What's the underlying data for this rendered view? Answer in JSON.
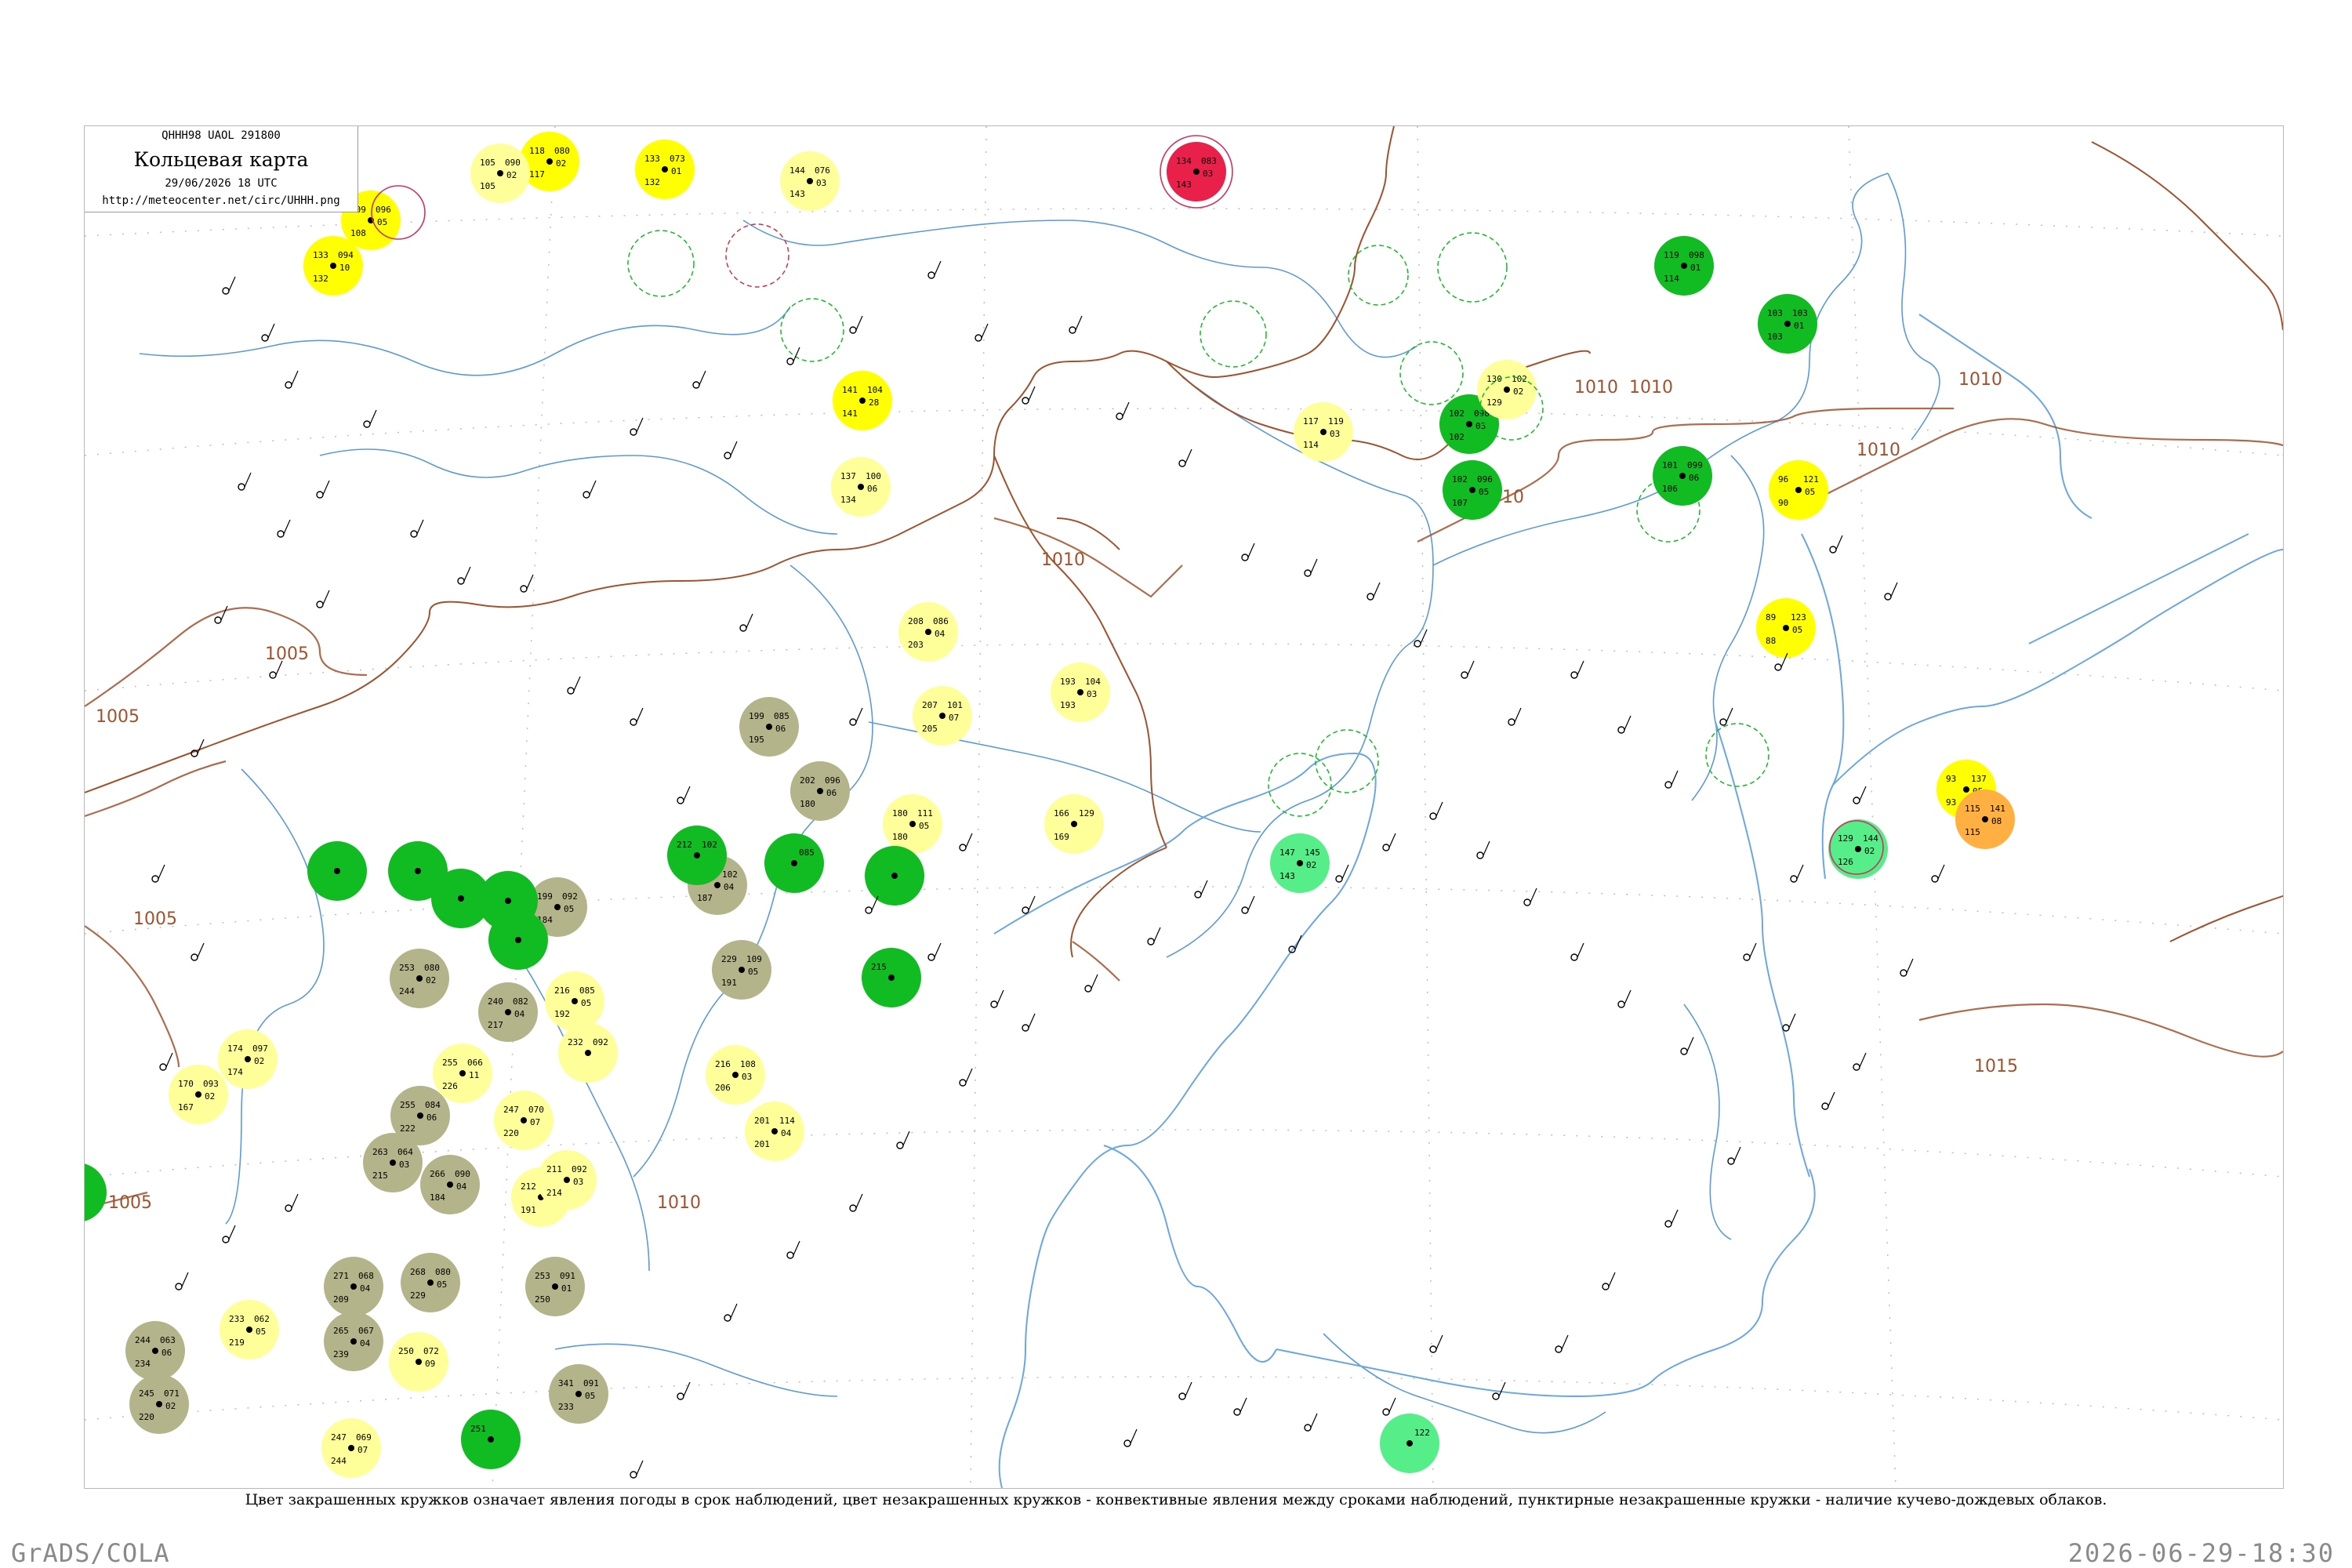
{
  "header": {
    "code_line": "QHHH98  UAOL  291800",
    "title": "Кольцевая карта",
    "datetime": "29/06/2026 18 UTC",
    "url": "http://meteocenter.net/circ/UHHH.png"
  },
  "caption": "Цвет закрашенных кружков означает явления погоды в срок наблюдений, цвет незакрашенных кружков - конвективные явления между сроками наблюдений, пунктирные незакрашенные кружки - наличие кучево-дождевых облаков.",
  "footer": {
    "left": "GrADS/COLA",
    "right": "2026-06-29-18:30"
  },
  "colors": {
    "isobar": "#a0522d",
    "river": "#5b9bd5",
    "coast": "#6aa7e0",
    "green_obs": "#11bb22",
    "yellow_obs": "#ffff00",
    "light_yellow_obs": "#ffff99",
    "olive_obs": "#b4b48a",
    "red_obs": "#e8204a",
    "light_green_obs": "#55ee88",
    "orange_obs": "#ffb040"
  },
  "isobar_labels": [
    "1005",
    "1005",
    "1005",
    "1005",
    "1010",
    "1010",
    "1010",
    "1010",
    "1010",
    "1010",
    "1010",
    "1015"
  ],
  "stations": [
    {
      "id": "31004",
      "top": "118",
      "bot": "117",
      "dp": "080",
      "tend": "02",
      "color": "yellow_obs"
    },
    {
      "id": "30469",
      "top": "133",
      "bot": "132",
      "dp": "073",
      "tend": "01",
      "color": "yellow_obs"
    },
    {
      "id": "31052",
      "top": "144",
      "bot": "143",
      "dp": "076",
      "tend": "03",
      "color": "light_yellow_obs"
    },
    {
      "id": "31707",
      "top": "134",
      "bot": "143",
      "dp": "083",
      "tend": "03",
      "color": "red_obs"
    },
    {
      "id": "30253",
      "top": "109",
      "bot": "108",
      "dp": "096",
      "tend": "05",
      "color": "yellow_obs"
    },
    {
      "id": "30554",
      "top": "133",
      "bot": "132",
      "dp": "094",
      "tend": "10",
      "color": "yellow_obs"
    },
    {
      "id": "30746",
      "top": "105",
      "bot": "105",
      "dp": "090",
      "tend": "02",
      "color": "light_yellow_obs"
    },
    {
      "id": "31348",
      "top": "141",
      "bot": "141",
      "dp": "104",
      "tend": "28",
      "color": "yellow_obs"
    },
    {
      "id": "31329",
      "top": "137",
      "bot": "134",
      "dp": "100",
      "tend": "06",
      "color": "light_yellow_obs"
    },
    {
      "id": "31169",
      "top": "119",
      "bot": "114",
      "dp": "098",
      "tend": "01",
      "color": "green_obs"
    },
    {
      "id": "31285",
      "top": "103",
      "bot": "103",
      "dp": "103",
      "tend": "01",
      "color": "green_obs"
    },
    {
      "id": "31348a",
      "top": "101",
      "bot": "106",
      "dp": "099",
      "tend": "06",
      "color": "green_obs"
    },
    {
      "id": "31621",
      "top": "117",
      "bot": "114",
      "dp": "119",
      "tend": "03",
      "color": "light_yellow_obs"
    },
    {
      "id": "31532",
      "top": "102",
      "bot": "102",
      "dp": "098",
      "tend": "03",
      "color": "green_obs"
    },
    {
      "id": "31418",
      "top": "130",
      "bot": "129",
      "dp": "102",
      "tend": "02",
      "color": "light_yellow_obs"
    },
    {
      "id": "31445",
      "top": "102",
      "bot": "107",
      "dp": "096",
      "tend": "05",
      "color": "green_obs"
    },
    {
      "id": "31298",
      "top": "96",
      "bot": "90",
      "dp": "121",
      "tend": "05",
      "color": "yellow_obs"
    },
    {
      "id": "31595",
      "top": "89",
      "bot": "88",
      "dp": "123",
      "tend": "05",
      "color": "yellow_obs"
    },
    {
      "id": "32098",
      "top": "93",
      "bot": "93",
      "dp": "137",
      "tend": "05",
      "color": "yellow_obs"
    },
    {
      "id": "32061",
      "top": "115",
      "bot": "115",
      "dp": "141",
      "tend": "08",
      "color": "orange_obs"
    },
    {
      "id": "47451",
      "top": "129",
      "bot": "126",
      "dp": "144",
      "tend": "02",
      "color": "light_green_obs"
    },
    {
      "id": "31960",
      "top": "147",
      "bot": "143",
      "dp": "145",
      "tend": "02",
      "color": "light_green_obs"
    },
    {
      "id": "50945",
      "top": "208",
      "bot": "203",
      "dp": "086",
      "tend": "04",
      "color": "light_yellow_obs"
    },
    {
      "id": "54026",
      "top": "199",
      "bot": "195",
      "dp": "085",
      "tend": "06",
      "color": "olive_obs"
    },
    {
      "id": "50949",
      "top": "207",
      "bot": "205",
      "dp": "101",
      "tend": "07",
      "color": "light_yellow_obs"
    },
    {
      "id": "50983",
      "top": "193",
      "bot": "193",
      "dp": "104",
      "tend": "03",
      "color": "light_yellow_obs"
    },
    {
      "id": "54094",
      "top": "202",
      "bot": "180",
      "dp": "096",
      "tend": "06",
      "color": "olive_obs"
    },
    {
      "id": "54157",
      "top": "180",
      "bot": "180",
      "dp": "111",
      "tend": "05",
      "color": "light_yellow_obs"
    },
    {
      "id": "54186",
      "top": "166",
      "bot": "169",
      "dp": "129",
      "tend": "",
      "color": "light_yellow_obs"
    },
    {
      "id": "54363",
      "top": "199",
      "bot": "184",
      "dp": "092",
      "tend": "05",
      "color": "olive_obs"
    },
    {
      "id": "54337",
      "top": "197",
      "bot": "187",
      "dp": "102",
      "tend": "04",
      "color": "olive_obs"
    },
    {
      "id": "54471",
      "top": "229",
      "bot": "191",
      "dp": "109",
      "tend": "05",
      "color": "olive_obs"
    },
    {
      "id": "54662",
      "top": "216",
      "bot": "206",
      "dp": "108",
      "tend": "03",
      "color": "light_yellow_obs"
    },
    {
      "id": "54776",
      "top": "201",
      "bot": "201",
      "dp": "114",
      "tend": "04",
      "color": "light_yellow_obs"
    },
    {
      "id": "54342",
      "top": "212",
      "bot": "",
      "dp": "102",
      "tend": "",
      "color": "green_obs"
    },
    {
      "id": "54493",
      "top": "215",
      "bot": "",
      "dp": "",
      "tend": "",
      "color": "green_obs"
    },
    {
      "id": "53698",
      "top": "253",
      "bot": "244",
      "dp": "080",
      "tend": "02",
      "color": "olive_obs"
    },
    {
      "id": "53772",
      "top": "240",
      "bot": "217",
      "dp": "082",
      "tend": "04",
      "color": "olive_obs"
    },
    {
      "id": "53915",
      "top": "255",
      "bot": "226",
      "dp": "066",
      "tend": "11",
      "color": "light_yellow_obs"
    },
    {
      "id": "54218",
      "top": "216",
      "bot": "192",
      "dp": "085",
      "tend": "05",
      "color": "light_yellow_obs"
    },
    {
      "id": "54308",
      "top": "232",
      "bot": "",
      "dp": "092",
      "tend": "",
      "color": "light_yellow_obs"
    },
    {
      "id": "53913",
      "top": "255",
      "bot": "222",
      "dp": "084",
      "tend": "06",
      "color": "olive_obs"
    },
    {
      "id": "53959",
      "top": "247",
      "bot": "220",
      "dp": "070",
      "tend": "07",
      "color": "light_yellow_obs"
    },
    {
      "id": "53787",
      "top": "174",
      "bot": "174",
      "dp": "097",
      "tend": "02",
      "color": "light_yellow_obs"
    },
    {
      "id": "53863",
      "top": "170",
      "bot": "167",
      "dp": "093",
      "tend": "02",
      "color": "light_yellow_obs"
    },
    {
      "id": "57083",
      "top": "263",
      "bot": "215",
      "dp": "064",
      "tend": "03",
      "color": "olive_obs"
    },
    {
      "id": "57178",
      "top": "266",
      "bot": "184",
      "dp": "090",
      "tend": "04",
      "color": "olive_obs"
    },
    {
      "id": "57245",
      "top": "212",
      "bot": "191",
      "dp": "095",
      "tend": "04",
      "color": "light_yellow_obs"
    },
    {
      "id": "57461",
      "top": "211",
      "bot": "214",
      "dp": "092",
      "tend": "03",
      "color": "light_yellow_obs"
    },
    {
      "id": "57181",
      "top": "271",
      "bot": "209",
      "dp": "068",
      "tend": "04",
      "color": "olive_obs"
    },
    {
      "id": "57297",
      "top": "268",
      "bot": "229",
      "dp": "080",
      "tend": "05",
      "color": "olive_obs"
    },
    {
      "id": "57494",
      "top": "253",
      "bot": "250",
      "dp": "091",
      "tend": "01",
      "color": "olive_obs"
    },
    {
      "id": "57245b",
      "top": "265",
      "bot": "239",
      "dp": "067",
      "tend": "04",
      "color": "olive_obs"
    },
    {
      "id": "57193",
      "top": "233",
      "bot": "219",
      "dp": "062",
      "tend": "05",
      "color": "light_yellow_obs"
    },
    {
      "id": "57679",
      "top": "244",
      "bot": "234",
      "dp": "063",
      "tend": "06",
      "color": "olive_obs"
    },
    {
      "id": "57816",
      "top": "245",
      "bot": "220",
      "dp": "071",
      "tend": "02",
      "color": "olive_obs"
    },
    {
      "id": "58221",
      "top": "250",
      "bot": "",
      "dp": "072",
      "tend": "09",
      "color": "light_yellow_obs"
    },
    {
      "id": "58347",
      "top": "341",
      "bot": "233",
      "dp": "091",
      "tend": "05",
      "color": "olive_obs"
    },
    {
      "id": "58016",
      "top": "247",
      "bot": "244",
      "dp": "069",
      "tend": "07",
      "color": "light_yellow_obs"
    },
    {
      "id": "58241",
      "top": "251",
      "bot": "",
      "dp": "",
      "tend": "",
      "color": "green_obs"
    },
    {
      "id": "47931",
      "top": "",
      "bot": "",
      "dp": "122",
      "tend": "",
      "color": "light_green_obs"
    },
    {
      "id": "52681",
      "top": "",
      "bot": "",
      "dp": "085",
      "tend": "",
      "color": "green_obs"
    },
    {
      "id": "53543",
      "top": "",
      "bot": "",
      "dp": "",
      "tend": "",
      "color": "green_obs"
    },
    {
      "id": "52842",
      "top": "",
      "bot": "",
      "dp": "",
      "tend": "",
      "color": "green_obs"
    },
    {
      "id": "52983",
      "top": "",
      "bot": "",
      "dp": "",
      "tend": "",
      "color": "green_obs"
    },
    {
      "id": "53063",
      "top": "",
      "bot": "",
      "dp": "",
      "tend": "",
      "color": "green_obs"
    },
    {
      "id": "53084",
      "top": "",
      "bot": "",
      "dp": "",
      "tend": "",
      "color": "green_obs"
    },
    {
      "id": "53192",
      "top": "",
      "bot": "",
      "dp": "",
      "tend": "",
      "color": "green_obs"
    },
    {
      "id": "52943",
      "top": "",
      "bot": "",
      "dp": "",
      "tend": "",
      "color": "green_obs"
    }
  ]
}
